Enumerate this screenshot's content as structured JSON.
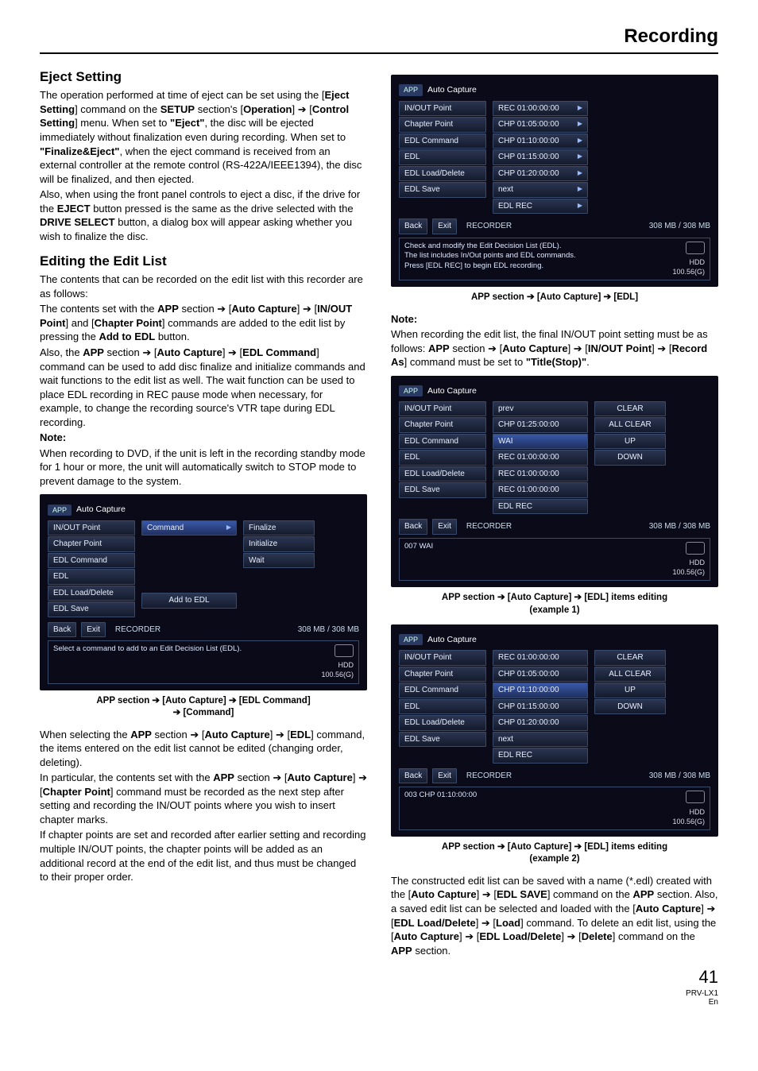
{
  "header": "Recording",
  "left": {
    "h1": "Eject Setting",
    "p1a": "The operation performed at time of eject can be set using the [",
    "p1b": "Eject Setting",
    "p1c": "] command on the ",
    "p1d": "SETUP",
    "p1e": " section's [",
    "p1f": "Operation",
    "p1g": "] ➔ [",
    "p1h": "Control Setting",
    "p1i": "] menu.",
    "p2a": "When set to ",
    "p2b": "\"Eject\"",
    "p2c": ", the disc will be ejected immediately without finalization even during recording. When set to ",
    "p2d": "\"Finalize&Eject\"",
    "p2e": ", when the eject command is received from an external controller at the remote control (RS-422A/IEEE1394), the disc will be finalized, and then ejected.",
    "p3a": "Also, when using the front panel controls to eject a disc, if the drive for the ",
    "p3b": "EJECT",
    "p3c": " button pressed is the same as the drive selected with the ",
    "p3d": "DRIVE SELECT",
    "p3e": " button, a dialog box will appear asking whether you wish to finalize the disc.",
    "h2": "Editing the Edit List",
    "p4": "The contents that can be recorded on the edit list with this recorder are as follows:",
    "p5a": "The contents set with the ",
    "p5b": "APP",
    "p5c": " section ➔ [",
    "p5d": "Auto Capture",
    "p5e": "] ➔ [",
    "p5f": "IN/OUT Point",
    "p5g": "] and [",
    "p5h": "Chapter Point",
    "p5i": "] commands are added to the edit list by pressing the ",
    "p5j": "Add to EDL",
    "p5k": " button.",
    "p6a": "Also, the ",
    "p6b": "APP",
    "p6c": " section ➔ [",
    "p6d": "Auto Capture",
    "p6e": "] ➔ [",
    "p6f": "EDL Command",
    "p6g": "] command can be used to add disc finalize and initialize commands and wait functions to the edit list as well. The wait function can be used to place EDL recording in REC pause mode when necessary, for example, to change the recording source's VTR tape during EDL recording.",
    "noteLabel": "Note:",
    "p7": "When recording to DVD, if the unit is left in the recording standby mode for 1 hour or more, the unit will automatically switch to STOP mode to prevent damage to the system.",
    "shot1": {
      "title": "Auto Capture",
      "menu": [
        "IN/OUT Point",
        "Chapter Point",
        "EDL Command",
        "EDL",
        "EDL Load/Delete",
        "EDL Save"
      ],
      "mid_sel": "Command",
      "mid_btn": "Add to EDL",
      "right": [
        "Finalize",
        "Initialize",
        "Wait"
      ],
      "back": "Back",
      "exit": "Exit",
      "rec": "RECORDER",
      "mb": "308 MB /  308 MB",
      "msg": "Select a command to add to an Edit Decision List (EDL).",
      "hdd": "HDD",
      "gb": "100.56(G)"
    },
    "cap1a": "APP section ➔ [Auto Capture] ➔ [EDL Command]",
    "cap1b": "➔ [Command]",
    "p8a": "When selecting the ",
    "p8aa": "APP",
    "p8b": " section ➔ [",
    "p8c": "Auto Capture",
    "p8d": "] ➔ [",
    "p8e": "EDL",
    "p8f": "] command, the items entered on the edit list cannot be edited (changing order, deleting).",
    "p9a": "In particular, the contents set with the ",
    "p9aa": "APP",
    "p9b": " section ➔ [",
    "p9c": "Auto Capture",
    "p9d": "] ➔ [",
    "p9e": "Chapter Point",
    "p9f": "] command must be recorded as the next step after setting and recording the IN/OUT points where you wish to insert chapter marks.",
    "p10": "If chapter points are set and recorded after earlier setting and recording multiple IN/OUT points, the chapter points will be added as an additional record at the end of the edit list, and thus must be changed to their proper order."
  },
  "right": {
    "shot2": {
      "title": "Auto Capture",
      "menu": [
        "IN/OUT Point",
        "Chapter Point",
        "EDL Command",
        "EDL",
        "EDL Load/Delete",
        "EDL Save"
      ],
      "mid": [
        "REC 01:00:00:00",
        "CHP 01:05:00:00",
        "CHP 01:10:00:00",
        "CHP 01:15:00:00",
        "CHP 01:20:00:00",
        "next",
        "EDL REC"
      ],
      "back": "Back",
      "exit": "Exit",
      "rec": "RECORDER",
      "mb": "308 MB /  308 MB",
      "msg": "Check and modify the Edit Decision List (EDL).\nThe list includes In/Out points and EDL commands.\nPress [EDL REC] to begin EDL recording.",
      "hdd": "HDD",
      "gb": "100.56(G)"
    },
    "cap2": "APP section ➔ [Auto Capture] ➔ [EDL]",
    "noteLabel": "Note:",
    "p1a": "When recording the edit list, the final IN/OUT point setting must be as follows: ",
    "p1b": "APP",
    "p1c": " section ➔ [",
    "p1d": "Auto Capture",
    "p1e": "] ➔ [",
    "p1f": "IN/OUT Point",
    "p1g": "] ➔ [",
    "p1h": "Record As",
    "p1i": "] command must be set to ",
    "p1j": "\"Title(Stop)\"",
    "p1k": ".",
    "shot3": {
      "title": "Auto Capture",
      "menu": [
        "IN/OUT Point",
        "Chapter Point",
        "EDL Command",
        "EDL",
        "EDL Load/Delete",
        "EDL Save"
      ],
      "mid": [
        "prev",
        "CHP 01:25:00:00",
        "WAI",
        "REC 01:00:00:00",
        "REC 01:00:00:00",
        "REC 01:00:00:00",
        "EDL REC"
      ],
      "midSel": 2,
      "right": [
        "CLEAR",
        "ALL CLEAR",
        "UP",
        "DOWN"
      ],
      "back": "Back",
      "exit": "Exit",
      "rec": "RECORDER",
      "mb": "308 MB /  308 MB",
      "status": "007   WAI",
      "hdd": "HDD",
      "gb": "100.56(G)"
    },
    "cap3a": "APP section ➔ [Auto Capture] ➔ [EDL] items editing",
    "cap3b": "(example 1)",
    "shot4": {
      "title": "Auto Capture",
      "menu": [
        "IN/OUT Point",
        "Chapter Point",
        "EDL Command",
        "EDL",
        "EDL Load/Delete",
        "EDL Save"
      ],
      "mid": [
        "REC 01:00:00:00",
        "CHP 01:05:00:00",
        "CHP 01:10:00:00",
        "CHP 01:15:00:00",
        "CHP 01:20:00:00",
        "next",
        "EDL REC"
      ],
      "midSel": 2,
      "right": [
        "CLEAR",
        "ALL CLEAR",
        "UP",
        "DOWN"
      ],
      "back": "Back",
      "exit": "Exit",
      "rec": "RECORDER",
      "mb": "308 MB /  308 MB",
      "status": "003   CHP 01:10:00:00",
      "hdd": "HDD",
      "gb": "100.56(G)"
    },
    "cap4a": "APP section ➔ [Auto Capture] ➔ [EDL] items editing",
    "cap4b": "(example 2)",
    "p2a": "The constructed edit list can be saved with a name (*.edl) created with the [",
    "p2b": "Auto Capture",
    "p2c": "] ➔ [",
    "p2d": "EDL SAVE",
    "p2e": "] command on the ",
    "p2f": "APP",
    "p2g": " section. Also, a saved edit list can be selected and loaded with the [",
    "p2h": "Auto Capture",
    "p2i": "] ➔ [",
    "p2j": "EDL Load/Delete",
    "p2k": "] ➔ [",
    "p2l": "Load",
    "p2m": "] command. To delete an edit list, using the [",
    "p2n": "Auto Capture",
    "p2o": "] ➔ [",
    "p2p": "EDL Load/Delete",
    "p2q": "] ➔ [",
    "p2r": "Delete",
    "p2s": "] command on the ",
    "p2t": "APP",
    "p2u": " section."
  },
  "page": "41",
  "model": "PRV-LX1",
  "lang": "En"
}
